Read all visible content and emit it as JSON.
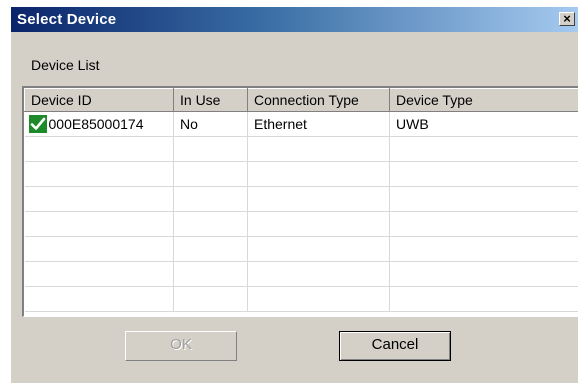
{
  "window": {
    "title": "Select Device",
    "close_glyph": "×"
  },
  "device_list": {
    "label": "Device List",
    "columns": [
      "Device ID",
      "In Use",
      "Connection Type",
      "Device Type"
    ],
    "rows": [
      {
        "checked": true,
        "status_icon": "green-check-icon",
        "device_id": "000E85000174",
        "in_use": "No",
        "connection_type": "Ethernet",
        "device_type": "UWB"
      }
    ],
    "empty_rows": 7
  },
  "buttons": {
    "ok_label": "OK",
    "ok_enabled": false,
    "cancel_label": "Cancel"
  },
  "colors": {
    "title_gradient_start": "#0a246a",
    "title_gradient_end": "#a6caf0",
    "dialog_bg": "#d4d0c8",
    "check_green": "#1f8a2a"
  }
}
